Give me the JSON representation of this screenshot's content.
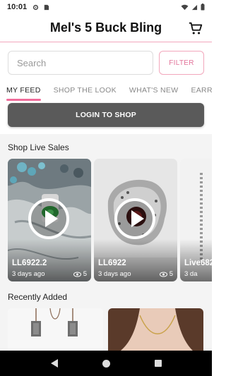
{
  "status": {
    "time": "10:01"
  },
  "app": {
    "title": "Mel's 5 Buck Bling"
  },
  "search": {
    "placeholder": "Search",
    "filter_label": "FILTER"
  },
  "tabs": [
    {
      "label": "MY FEED",
      "active": true
    },
    {
      "label": "SHOP THE LOOK",
      "active": false
    },
    {
      "label": "WHAT'S NEW",
      "active": false
    },
    {
      "label": "EARRING",
      "active": false
    }
  ],
  "login": {
    "label": "LOGIN TO SHOP"
  },
  "live_sales": {
    "title": "Shop Live Sales",
    "cards": [
      {
        "code": "LL6922.2",
        "age": "3 days ago",
        "views": "5"
      },
      {
        "code": "LL6922",
        "age": "3 days ago",
        "views": "5"
      },
      {
        "code": "Live682",
        "age": "3 da",
        "views": ""
      }
    ]
  },
  "recently_added": {
    "title": "Recently Added"
  },
  "colors": {
    "accent": "#f06c9a",
    "login_bg": "#5a5a5a"
  }
}
